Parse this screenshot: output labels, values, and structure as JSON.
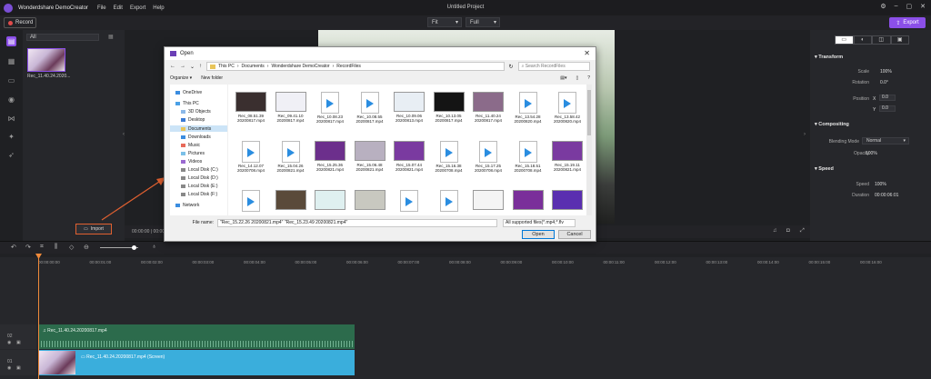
{
  "app": {
    "name": "Wonderdshare DemoCreator",
    "menu": [
      "File",
      "Edit",
      "Export",
      "Help"
    ],
    "window_title": "Untitled Project"
  },
  "toolbar": {
    "record_label": "Record",
    "fit_value": "Fit",
    "full_value": "Full",
    "export_label": "Export"
  },
  "media": {
    "filter_value": "All",
    "thumb_label": "Rec_11.40.24.2020...",
    "import_label": "Import"
  },
  "player": {
    "time": "00:00:00 | 00:00:06"
  },
  "properties": {
    "transform_title": "Transform",
    "scale_label": "Scale",
    "scale_value": "100%",
    "rotation_label": "Rotation",
    "rotation_value": "0.0°",
    "position_label": "Position",
    "x_label": "X",
    "x_value": "0.0",
    "y_label": "Y",
    "y_value": "0.0",
    "compositing_title": "Compositing",
    "blending_label": "Blending Mode",
    "blending_value": "Normal",
    "opacity_label": "Opacity",
    "opacity_value": "100%",
    "speed_title": "Speed",
    "speed_label": "Speed",
    "speed_value": "100%",
    "duration_label": "Duration",
    "duration_value": "00:00:06:01"
  },
  "timeline": {
    "ticks": [
      "00:00:00:00",
      "00:00:01:00",
      "00:00:02:00",
      "00:00:03:00",
      "00:00:04:00",
      "00:00:05:00",
      "00:00:06:00",
      "00:00:07:00",
      "00:00:08:00",
      "00:00:09:00",
      "00:00:10:00",
      "00:00:11:00",
      "00:00:12:00",
      "00:00:13:00",
      "00:00:14:00",
      "00:00:15:00",
      "00:00:16:00"
    ],
    "track2_num": "02",
    "track1_num": "01",
    "audio_clip": "Rec_11.40.24.20200817.mp4",
    "video_clip": "Rec_11.40.24.20200817.mp4 (Screen)"
  },
  "dialog": {
    "title": "Open",
    "breadcrumb": [
      "This PC",
      "Documents",
      "Wonderdshare DemoCreator",
      "RecordFiles"
    ],
    "search_placeholder": "Search RecordFiles",
    "organize_label": "Organize ▾",
    "new_folder_label": "New folder",
    "nav": [
      "OneDrive",
      "This PC",
      "3D Objects",
      "Desktop",
      "Documents",
      "Downloads",
      "Music",
      "Pictures",
      "Videos",
      "Local Disk (C:)",
      "Local Disk (D:)",
      "Local Disk (E:)",
      "Local Disk (F:)",
      "Network"
    ],
    "files": [
      {
        "l1": "Rec_08.51.39",
        "l2": "20200817.mp4",
        "kind": "thumb",
        "color": "#3a2f2f"
      },
      {
        "l1": "Rec_09.41.10",
        "l2": "20200817.mp4",
        "kind": "thumb",
        "color": "#f0f0f6"
      },
      {
        "l1": "Rec_10.08.23",
        "l2": "20200817.mp4",
        "kind": "doc"
      },
      {
        "l1": "Rec_10.08.55",
        "l2": "20200817.mp4",
        "kind": "doc"
      },
      {
        "l1": "Rec_10.09.06",
        "l2": "20200813.mp4",
        "kind": "thumb",
        "color": "#e8eef4"
      },
      {
        "l1": "Rec_10.13.05",
        "l2": "20200817.mp4",
        "kind": "thumb",
        "color": "#141414"
      },
      {
        "l1": "Rec_11.40.24",
        "l2": "20200817.mp4",
        "kind": "thumb",
        "color": "#8b6b8a"
      },
      {
        "l1": "Rec_13.54.28",
        "l2": "20200820.mp4",
        "kind": "doc"
      },
      {
        "l1": "Rec_13.58.42",
        "l2": "20200820.mp4",
        "kind": "doc"
      },
      {
        "l1": "Rec_14.12.07",
        "l2": "20200708.mp4",
        "kind": "doc"
      },
      {
        "l1": "Rec_15.04.26",
        "l2": "20200821.mp4",
        "kind": "doc"
      },
      {
        "l1": "Rec_15.25.36",
        "l2": "20200821.mp4",
        "kind": "thumb",
        "color": "#6c2f8c"
      },
      {
        "l1": "Rec_15.06.48",
        "l2": "20200821.mp4",
        "kind": "thumb",
        "color": "#b8b0c0"
      },
      {
        "l1": "Rec_15.07.44",
        "l2": "20200821.mp4",
        "kind": "thumb",
        "color": "#7a3aa0"
      },
      {
        "l1": "Rec_15.16.38",
        "l2": "20200708.mp4",
        "kind": "doc"
      },
      {
        "l1": "Rec_15.17.25",
        "l2": "20200708.mp4",
        "kind": "doc"
      },
      {
        "l1": "Rec_15.18.51",
        "l2": "20200708.mp4",
        "kind": "doc"
      },
      {
        "l1": "Rec_15.19.11",
        "l2": "20200821.mp4",
        "kind": "thumb",
        "color": "#7a3aa0"
      },
      {
        "l1": "",
        "l2": "",
        "kind": "doc"
      },
      {
        "l1": "",
        "l2": "",
        "kind": "thumb",
        "color": "#5a4a3a"
      },
      {
        "l1": "",
        "l2": "",
        "kind": "thumb",
        "color": "#dff0f0"
      },
      {
        "l1": "",
        "l2": "",
        "kind": "thumb",
        "color": "#c8c8c0"
      },
      {
        "l1": "",
        "l2": "",
        "kind": "doc"
      },
      {
        "l1": "",
        "l2": "",
        "kind": "doc"
      },
      {
        "l1": "",
        "l2": "",
        "kind": "thumb",
        "color": "#f4f4f4"
      },
      {
        "l1": "",
        "l2": "",
        "kind": "thumb",
        "color": "#7a2f9a"
      },
      {
        "l1": "",
        "l2": "",
        "kind": "thumb",
        "color": "#5a2fb0"
      }
    ],
    "filename_label": "File name:",
    "filename_value": "\"Rec_15.22.26 20200821.mp4\" \"Rec_15.23.49 20200821.mp4\"",
    "filetype_value": "All supported files(*.mp4;*.flv",
    "open_label": "Open",
    "cancel_label": "Cancel"
  },
  "colors": {
    "accent": "#8b4fe8",
    "audio_clip": "#2c6b4c",
    "video_clip": "#3aaedc",
    "highlight": "#e06030"
  }
}
